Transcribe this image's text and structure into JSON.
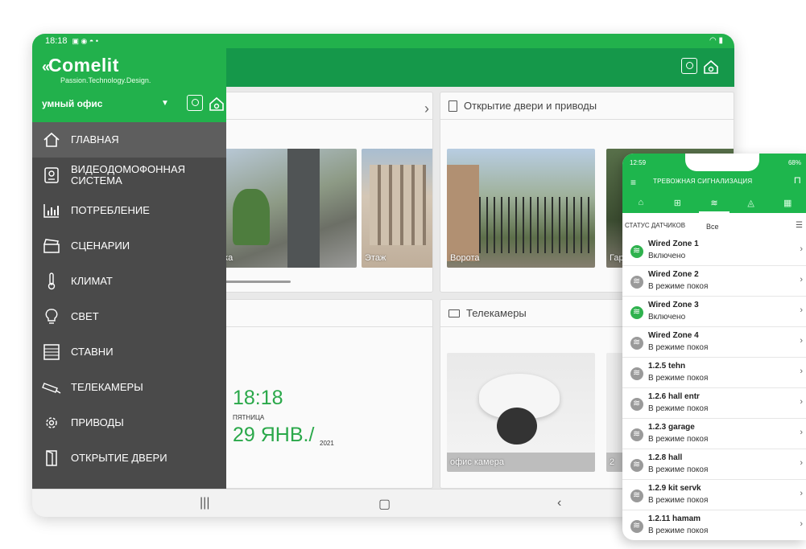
{
  "tablet": {
    "status_time": "18:18",
    "brand": "Comelit",
    "tagline": "Passion.Technology.Design.",
    "office": "умный офис",
    "menu": [
      {
        "label": "ГЛАВНАЯ",
        "icon": "home-icon",
        "active": true
      },
      {
        "label": "ВИДЕОДОМОФОННАЯ СИСТЕМА",
        "icon": "intercom-icon"
      },
      {
        "label": "ПОТРЕБЛЕНИЕ",
        "icon": "chart-icon"
      },
      {
        "label": "СЦЕНАРИИ",
        "icon": "clapper-icon"
      },
      {
        "label": "КЛИМАТ",
        "icon": "thermometer-icon"
      },
      {
        "label": "СВЕТ",
        "icon": "bulb-icon"
      },
      {
        "label": "СТАВНИ",
        "icon": "shutter-icon"
      },
      {
        "label": "ТЕЛЕКАМЕРЫ",
        "icon": "camera-icon"
      },
      {
        "label": "ПРИВОДЫ",
        "icon": "gear-icon"
      },
      {
        "label": "ОТКРЫТИЕ ДВЕРИ",
        "icon": "door-icon"
      }
    ],
    "cards": {
      "doors_title": "Открытие двери и приводы",
      "cams_title": "Телекамеры",
      "thumb_labels": [
        "тка",
        "Этаж",
        "Ворота",
        "Гар",
        "офис камера",
        "2"
      ]
    },
    "clock": {
      "time": "18:18",
      "weekday": "ПЯТНИЦА",
      "date": "29 ЯНВ./",
      "year": "2021"
    }
  },
  "phone": {
    "status_time": "12:59",
    "battery": "68%",
    "title": "ТРЕВОЖНАЯ СИГНАЛИЗАЦИЯ",
    "filter_label": "СТАТУС ДАТЧИКОВ",
    "filter_value": "Все",
    "tabs": [
      "lock-icon",
      "grid-icon",
      "sensor-icon",
      "bell-icon",
      "calendar-icon"
    ],
    "zones": [
      {
        "name": "Wired Zone 1",
        "state": "Включено",
        "on": true
      },
      {
        "name": "Wired Zone 2",
        "state": "В режиме покоя",
        "on": false
      },
      {
        "name": "Wired Zone 3",
        "state": "Включено",
        "on": true
      },
      {
        "name": "Wired Zone 4",
        "state": "В режиме покоя",
        "on": false
      },
      {
        "name": "1.2.5 tehn",
        "state": "В режиме покоя",
        "on": false
      },
      {
        "name": "1.2.6 hall entr",
        "state": "В режиме покоя",
        "on": false
      },
      {
        "name": "1.2.3 garage",
        "state": "В режиме покоя",
        "on": false
      },
      {
        "name": "1.2.8 hall",
        "state": "В режиме покоя",
        "on": false
      },
      {
        "name": "1.2.9 kit servk",
        "state": "В режиме покоя",
        "on": false
      },
      {
        "name": "1.2.11 hamam",
        "state": "В режиме покоя",
        "on": false
      }
    ]
  }
}
